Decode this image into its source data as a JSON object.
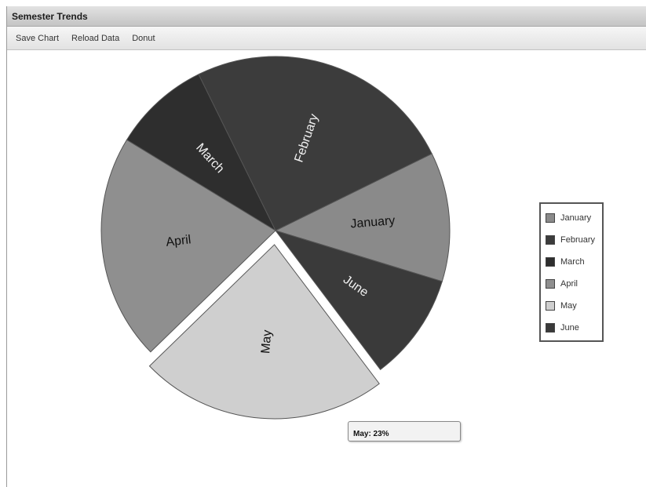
{
  "window": {
    "title": "Semester Trends"
  },
  "toolbar": {
    "save_label": "Save Chart",
    "reload_label": "Reload Data",
    "donut_label": "Donut"
  },
  "chart_data": {
    "type": "pie",
    "categories": [
      "January",
      "February",
      "March",
      "April",
      "May",
      "June"
    ],
    "values": [
      12,
      25,
      9,
      21,
      23,
      10
    ],
    "colors": [
      "#8a8a8a",
      "#3c3c3c",
      "#2e2e2e",
      "#8f8f8f",
      "#cfcfcf",
      "#3a3a3a"
    ],
    "exploded": "May",
    "legend_position": "right"
  },
  "tooltip": {
    "text": "May: 23%"
  }
}
